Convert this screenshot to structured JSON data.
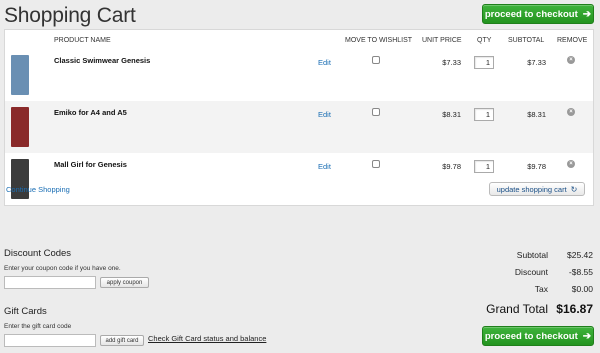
{
  "page": {
    "title": "Shopping Cart"
  },
  "checkout": {
    "label": "proceed to checkout"
  },
  "table": {
    "headers": {
      "product": "PRODUCT NAME",
      "wishlist": "MOVE TO WISHLIST",
      "unit_price": "UNIT PRICE",
      "qty": "QTY",
      "subtotal": "SUBTOTAL",
      "remove": "REMOVE"
    },
    "rows": [
      {
        "name": "Classic Swimwear Genesis",
        "edit": "Edit",
        "unit_price": "$7.33",
        "qty": "1",
        "subtotal": "$7.33",
        "thumb_color": "#6a8fb3"
      },
      {
        "name": "Emiko for A4 and A5",
        "edit": "Edit",
        "unit_price": "$8.31",
        "qty": "1",
        "subtotal": "$8.31",
        "thumb_color": "#8a2a2a"
      },
      {
        "name": "Mall Girl for Genesis",
        "edit": "Edit",
        "unit_price": "$9.78",
        "qty": "1",
        "subtotal": "$9.78",
        "thumb_color": "#3b3b3b"
      }
    ]
  },
  "cart_actions": {
    "continue": "Continue Shopping",
    "update": "update shopping cart"
  },
  "discount": {
    "title": "Discount Codes",
    "hint": "Enter your coupon code if you have one.",
    "button": "apply coupon"
  },
  "gift": {
    "title": "Gift Cards",
    "hint": "Enter the gift card code",
    "button": "add gift card",
    "link": "Check Gift Card status and balance"
  },
  "totals": {
    "subtotal_label": "Subtotal",
    "subtotal": "$25.42",
    "discount_label": "Discount",
    "discount": "-$8.55",
    "tax_label": "Tax",
    "tax": "$0.00",
    "grand_label": "Grand Total",
    "grand": "$16.87"
  },
  "colors": {
    "accent": "#23941f",
    "link": "#1a6eb4"
  },
  "icons": {
    "checkout_arrow": "arrow-right-icon",
    "refresh": "refresh-icon",
    "remove": "close-circle-icon"
  }
}
